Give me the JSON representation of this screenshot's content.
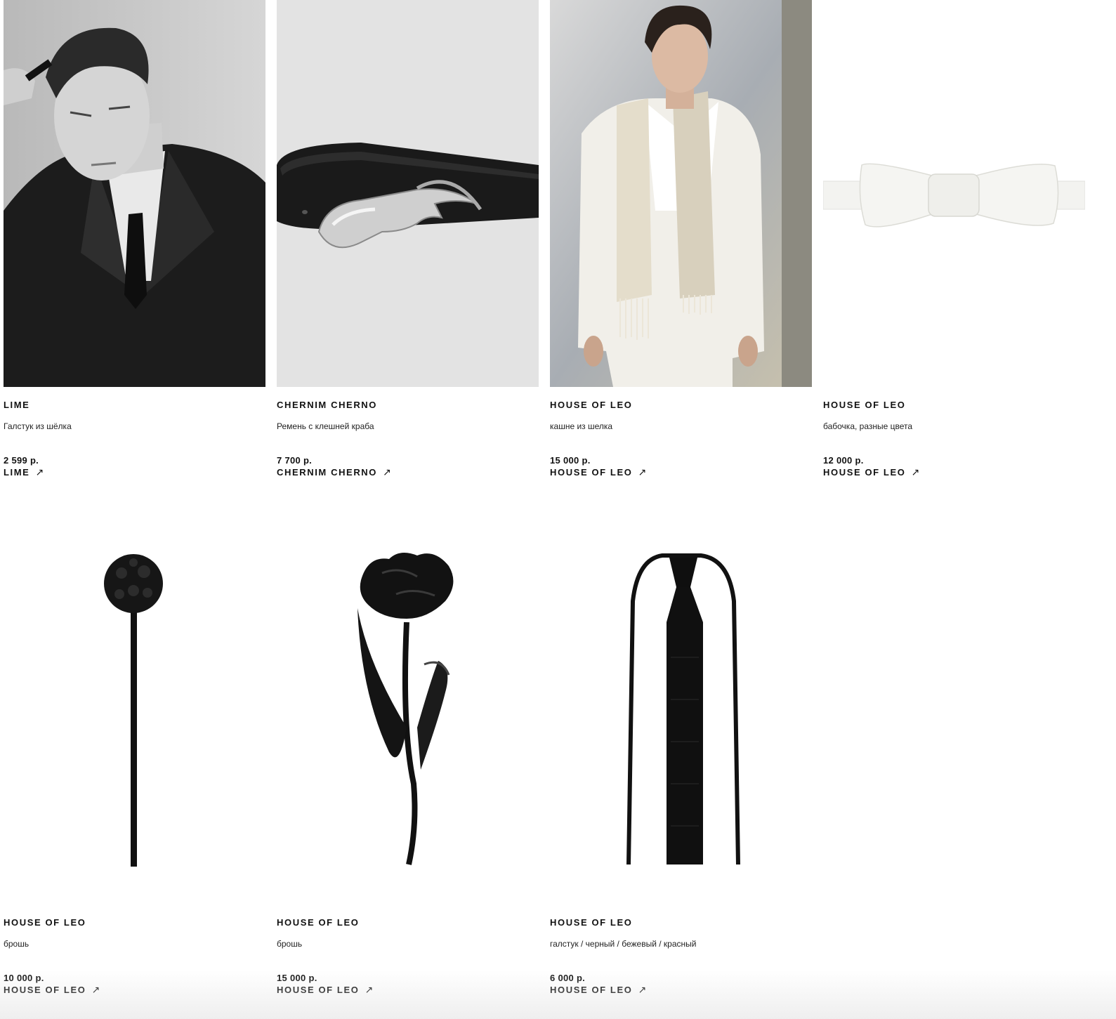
{
  "products": [
    {
      "brand": "LIME",
      "description": "Галстук из шёлка",
      "price": "2 599 р.",
      "link_label": "LIME",
      "arrow": "↗"
    },
    {
      "brand": "CHERNIM CHERNO",
      "description": "Ремень с клешней краба",
      "price": "7 700 р.",
      "link_label": "CHERNIM CHERNO",
      "arrow": "↗"
    },
    {
      "brand": "HOUSE OF LEO",
      "description": "кашне из шелка",
      "price": "15 000 р.",
      "link_label": "HOUSE OF LEO",
      "arrow": "↗"
    },
    {
      "brand": "HOUSE OF LEO",
      "description": "бабочка, разные цвета",
      "price": "12 000 р.",
      "link_label": "HOUSE OF LEO",
      "arrow": "↗"
    },
    {
      "brand": "HOUSE OF LEO",
      "description": "брошь",
      "price": "10 000 р.",
      "link_label": "HOUSE OF LEO",
      "arrow": "↗"
    },
    {
      "brand": "HOUSE OF LEO",
      "description": "брошь",
      "price": "15 000 р.",
      "link_label": "HOUSE OF LEO",
      "arrow": "↗"
    },
    {
      "brand": "HOUSE OF LEO",
      "description": "галстук / черный / бежевый / красный",
      "price": "6 000 р.",
      "link_label": "HOUSE OF LEO",
      "arrow": "↗"
    }
  ]
}
